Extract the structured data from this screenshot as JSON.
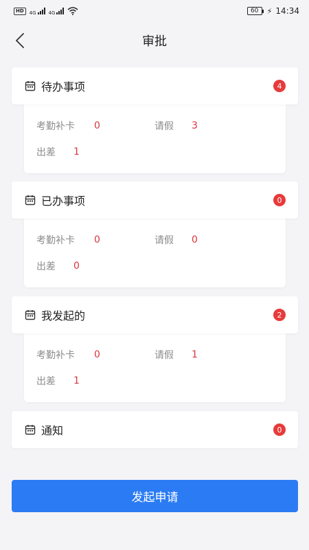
{
  "status_bar": {
    "hd": "HD",
    "net1": "4G",
    "net2": "4G",
    "battery": "60",
    "time": "14:34"
  },
  "nav": {
    "title": "审批"
  },
  "sections": [
    {
      "title": "待办事项",
      "badge": "4",
      "stats": {
        "attendance_label": "考勤补卡",
        "attendance_value": "0",
        "leave_label": "请假",
        "leave_value": "3",
        "trip_label": "出差",
        "trip_value": "1"
      }
    },
    {
      "title": "已办事项",
      "badge": "0",
      "stats": {
        "attendance_label": "考勤补卡",
        "attendance_value": "0",
        "leave_label": "请假",
        "leave_value": "0",
        "trip_label": "出差",
        "trip_value": "0"
      }
    },
    {
      "title": "我发起的",
      "badge": "2",
      "stats": {
        "attendance_label": "考勤补卡",
        "attendance_value": "0",
        "leave_label": "请假",
        "leave_value": "1",
        "trip_label": "出差",
        "trip_value": "1"
      }
    },
    {
      "title": "通知",
      "badge": "0"
    }
  ],
  "submit_label": "发起申请",
  "icons": {
    "back": "chevron-left-icon",
    "section": "calendar-icon"
  },
  "colors": {
    "accent": "#2b7cf4",
    "badge": "#e73b3b",
    "value": "#d9363e"
  }
}
